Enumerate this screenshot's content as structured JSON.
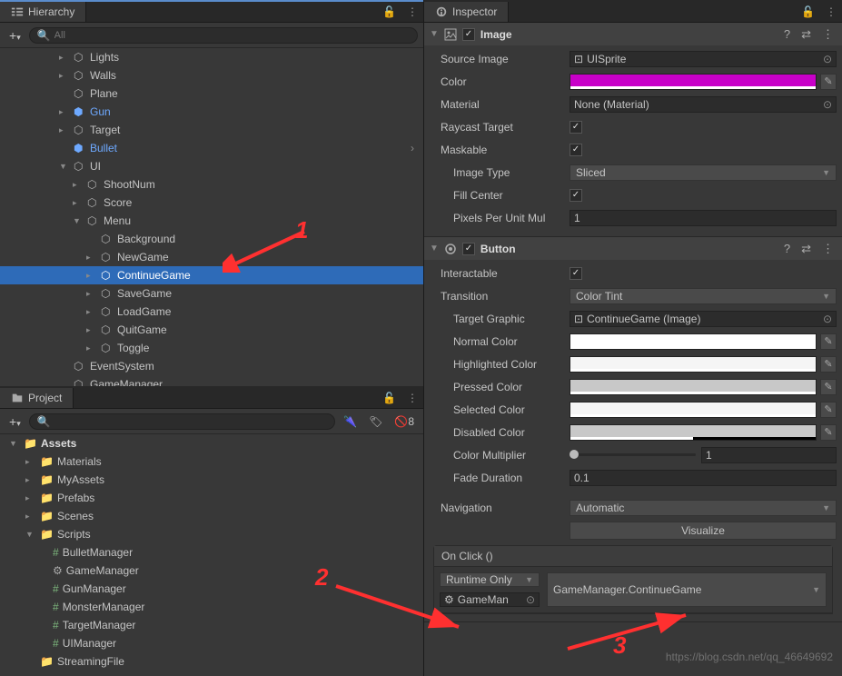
{
  "hierarchy": {
    "title": "Hierarchy",
    "search_placeholder": "All",
    "items": {
      "lights": "Lights",
      "walls": "Walls",
      "plane": "Plane",
      "gun": "Gun",
      "target": "Target",
      "bullet": "Bullet",
      "ui": "UI",
      "shootnum": "ShootNum",
      "score": "Score",
      "menu": "Menu",
      "background": "Background",
      "newgame": "NewGame",
      "continuegame": "ContinueGame",
      "savegame": "SaveGame",
      "loadgame": "LoadGame",
      "quitgame": "QuitGame",
      "toggle": "Toggle",
      "eventsystem": "EventSystem",
      "gamemanager": "GameManager"
    }
  },
  "project": {
    "title": "Project",
    "visibility_count": "8",
    "root": "Assets",
    "folders": {
      "materials": "Materials",
      "myassets": "MyAssets",
      "prefabs": "Prefabs",
      "scenes": "Scenes",
      "scripts": "Scripts",
      "streamingfile": "StreamingFile"
    },
    "scripts": {
      "bulletmanager": "BulletManager",
      "gamemanager": "GameManager",
      "gunmanager": "GunManager",
      "monstermanager": "MonsterManager",
      "targetmanager": "TargetManager",
      "uimanager": "UIManager"
    }
  },
  "inspector": {
    "title": "Inspector",
    "image": {
      "name": "Image",
      "source_image_label": "Source Image",
      "source_image_value": "UISprite",
      "color_label": "Color",
      "color_value": "#c800c8",
      "material_label": "Material",
      "material_value": "None (Material)",
      "raycast_label": "Raycast Target",
      "maskable_label": "Maskable",
      "image_type_label": "Image Type",
      "image_type_value": "Sliced",
      "fill_center_label": "Fill Center",
      "ppu_label": "Pixels Per Unit Mul",
      "ppu_value": "1"
    },
    "button": {
      "name": "Button",
      "interactable_label": "Interactable",
      "transition_label": "Transition",
      "transition_value": "Color Tint",
      "target_graphic_label": "Target Graphic",
      "target_graphic_value": "ContinueGame (Image)",
      "normal_color_label": "Normal Color",
      "highlighted_color_label": "Highlighted Color",
      "pressed_color_label": "Pressed Color",
      "selected_color_label": "Selected Color",
      "disabled_color_label": "Disabled Color",
      "color_multiplier_label": "Color Multiplier",
      "color_multiplier_value": "1",
      "fade_duration_label": "Fade Duration",
      "fade_duration_value": "0.1",
      "navigation_label": "Navigation",
      "navigation_value": "Automatic",
      "visualize_label": "Visualize",
      "onclick_label": "On Click ()",
      "runtime_value": "Runtime Only",
      "onclick_target": "GameMan",
      "onclick_method": "GameManager.ContinueGame"
    }
  },
  "annotations": {
    "n1": "1",
    "n2": "2",
    "n3": "3"
  },
  "watermark": "https://blog.csdn.net/qq_46649692"
}
